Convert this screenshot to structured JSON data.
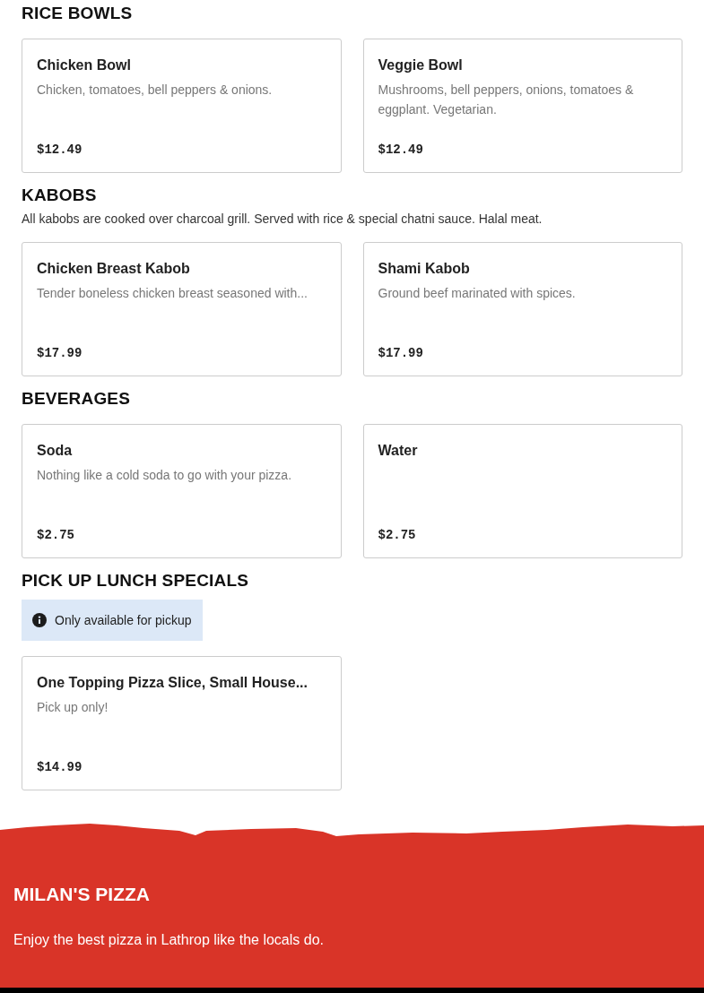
{
  "sections": [
    {
      "title": "RICE BOWLS",
      "items": [
        {
          "name": "Chicken Bowl",
          "description": "Chicken, tomatoes, bell peppers & onions.",
          "price": "$12.49"
        },
        {
          "name": "Veggie Bowl",
          "description": "Mushrooms, bell peppers, onions, tomatoes & eggplant. Vegetarian.",
          "price": "$12.49"
        }
      ]
    },
    {
      "title": "KABOBS",
      "description": "All kabobs are cooked over charcoal grill. Served with rice & special chatni sauce. Halal meat.",
      "items": [
        {
          "name": "Chicken Breast Kabob",
          "description": "Tender boneless chicken breast seasoned with...",
          "price": "$17.99"
        },
        {
          "name": "Shami Kabob",
          "description": "Ground beef marinated with spices.",
          "price": "$17.99"
        }
      ]
    },
    {
      "title": "BEVERAGES",
      "items": [
        {
          "name": "Soda",
          "description": "Nothing like a cold soda to go with your pizza.",
          "price": "$2.75"
        },
        {
          "name": "Water",
          "price": "$2.75"
        }
      ]
    },
    {
      "title": "PICK UP LUNCH SPECIALS",
      "notice": "Only available for pickup",
      "items": [
        {
          "name": "One Topping Pizza Slice, Small House...",
          "description": "Pick up only!",
          "price": "$14.99"
        }
      ]
    }
  ],
  "footer": {
    "brand": "MILAN'S PIZZA",
    "tagline": "Enjoy the best pizza in Lathrop like the locals do."
  }
}
